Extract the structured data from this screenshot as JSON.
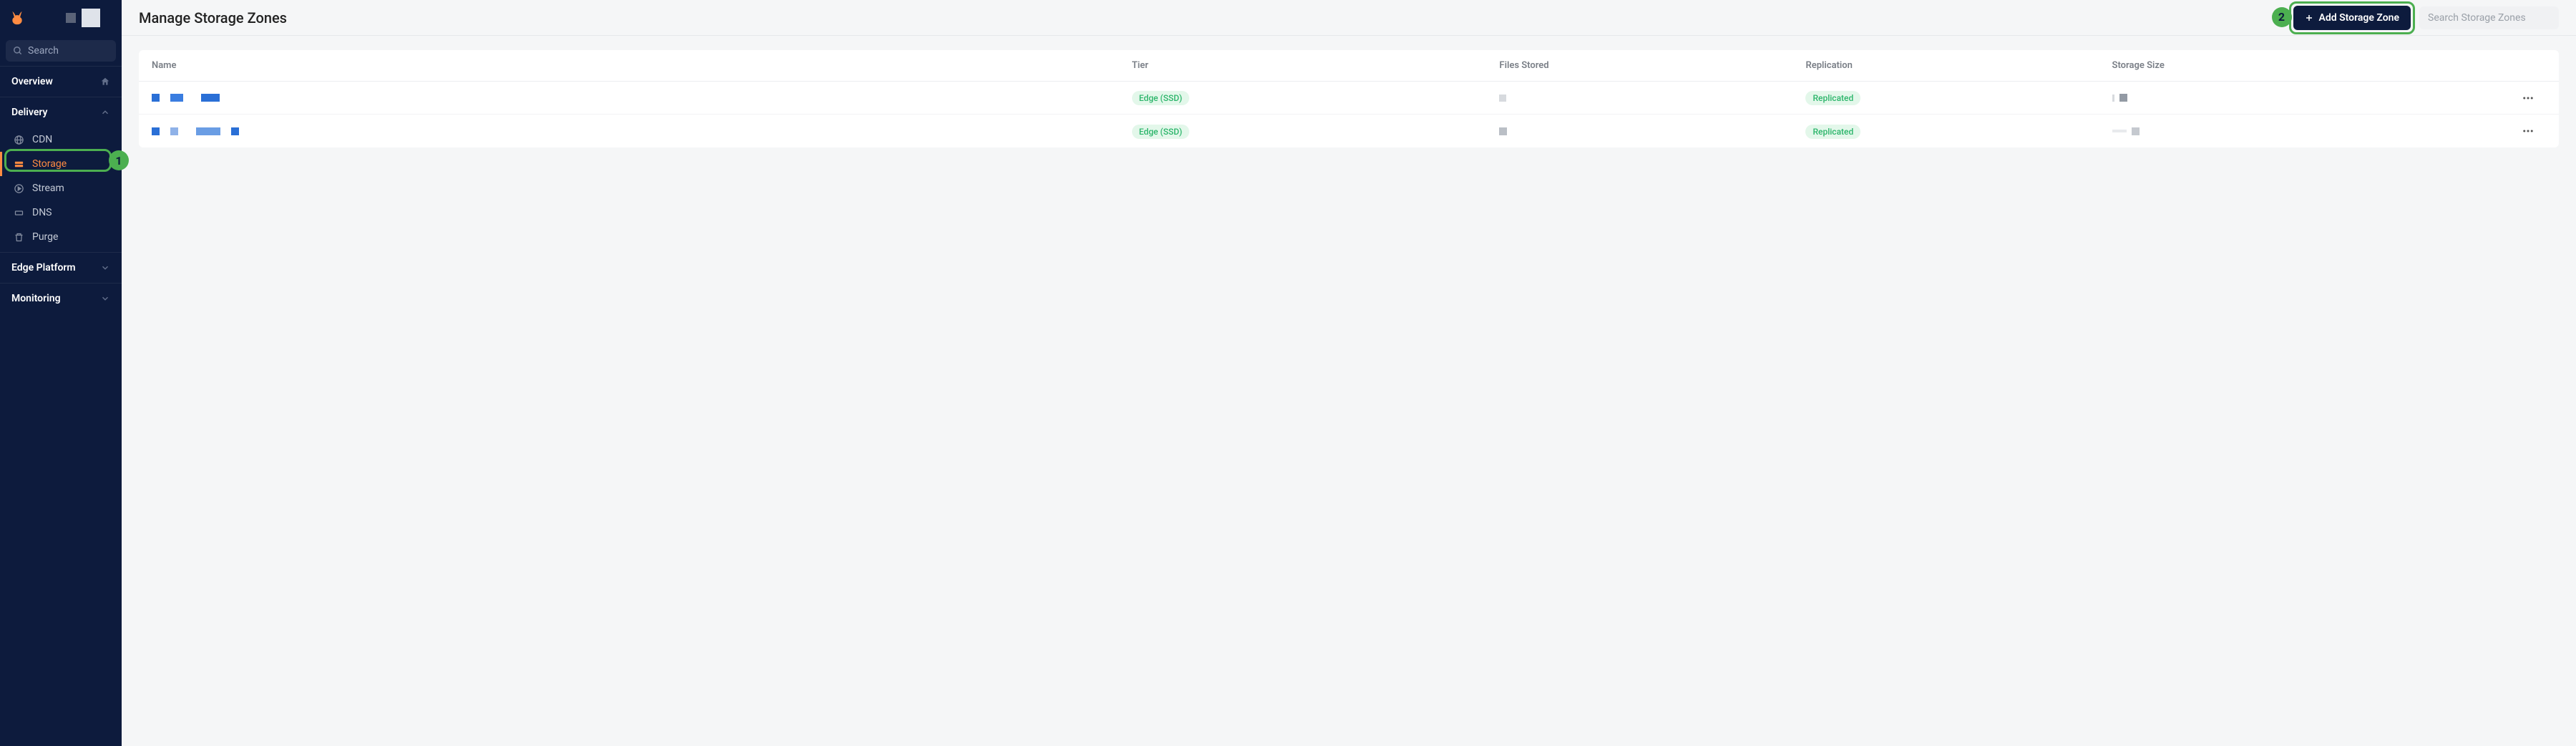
{
  "sidebar": {
    "search_label": "Search",
    "sections": {
      "overview": "Overview",
      "delivery": "Delivery",
      "edge": "Edge Platform",
      "monitoring": "Monitoring"
    },
    "delivery_items": {
      "cdn": "CDN",
      "storage": "Storage",
      "stream": "Stream",
      "dns": "DNS",
      "purge": "Purge"
    }
  },
  "header": {
    "title": "Manage Storage Zones",
    "add_button": "Add Storage Zone",
    "search_placeholder": "Search Storage Zones"
  },
  "table": {
    "columns": {
      "name": "Name",
      "tier": "Tier",
      "files": "Files Stored",
      "replication": "Replication",
      "size": "Storage Size"
    },
    "rows": [
      {
        "tier": "Edge (SSD)",
        "replication": "Replicated"
      },
      {
        "tier": "Edge (SSD)",
        "replication": "Replicated"
      }
    ]
  },
  "callouts": {
    "one": "1",
    "two": "2"
  },
  "colors": {
    "accent": "#ff8c42",
    "sidebar_bg": "#0d1b3d",
    "highlight": "#4caf50",
    "pill_bg": "#e3f7ea",
    "pill_fg": "#2bb56a"
  }
}
